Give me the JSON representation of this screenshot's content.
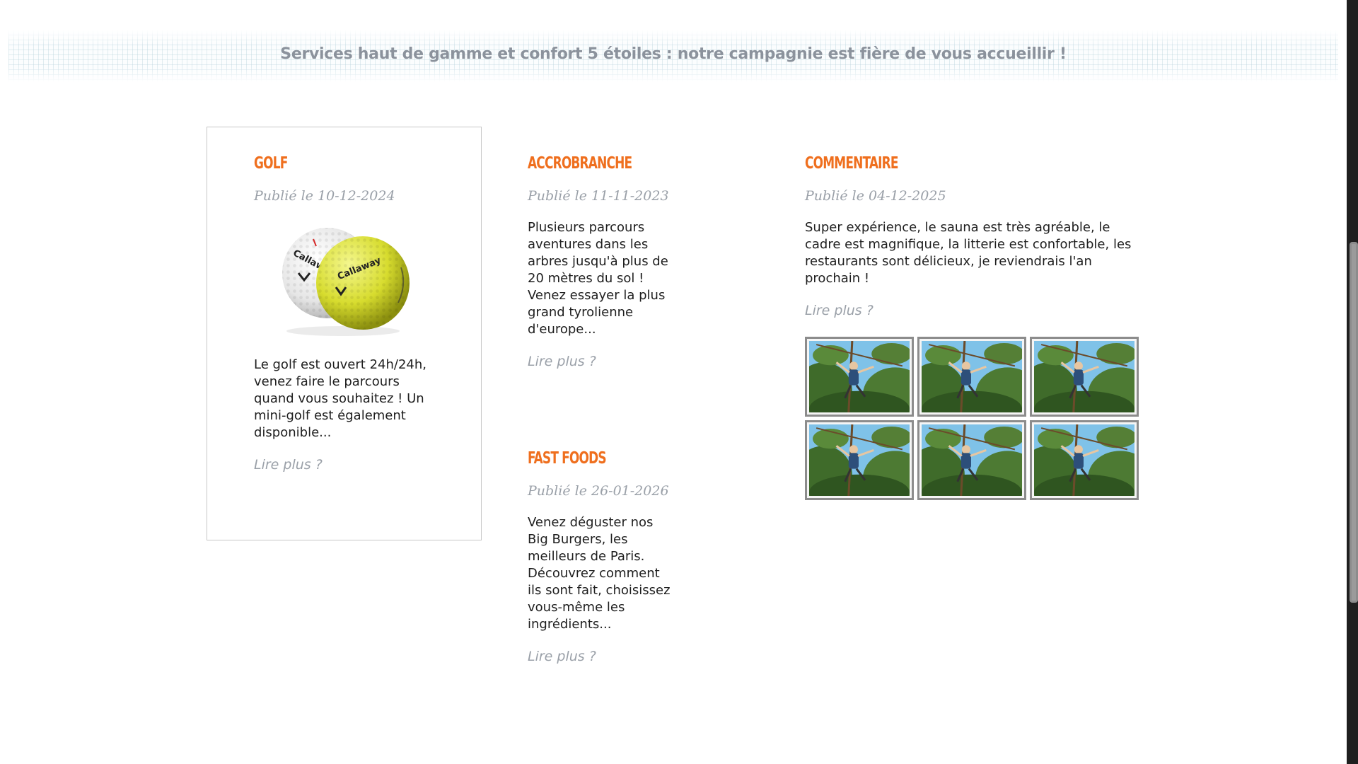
{
  "banner": {
    "tagline": "Services haut de gamme et confort 5 étoiles : notre campagnie est fière de vous accueillir !"
  },
  "posts": {
    "golf": {
      "title": "GOLF",
      "date": "Publié le 10-12-2024",
      "image_caption": "Callaway",
      "text": "Le golf est ouvert 24h/24h, venez faire le parcours quand vous souhaitez ! Un mini-golf est également disponible...",
      "read_more": "Lire plus ?"
    },
    "accrobranche": {
      "title": "ACCROBRANCHE",
      "date": "Publié le 11-11-2023",
      "text": "Plusieurs parcours aventures dans les arbres jusqu'à plus de 20 mètres du sol ! Venez essayer la plus grand tyrolienne d'europe...",
      "read_more": "Lire plus ?"
    },
    "fastfoods": {
      "title": "FAST FOODS",
      "date": "Publié le 26-01-2026",
      "text": "Venez déguster nos Big Burgers, les meilleurs de Paris. Découvrez comment ils sont fait, choisissez vous-même les ingrédients...",
      "read_more": "Lire plus ?"
    },
    "commentaire": {
      "title": "COMMENTAIRE",
      "date": "Publié le 04-12-2025",
      "text": "Super expérience, le sauna est très agréable, le cadre est magnifique, la litterie est confortable, les restaurants sont délicieux, je reviendrais l'an prochain !",
      "read_more": "Lire plus ?"
    }
  },
  "gallery": {
    "count": 6,
    "image_icon": "treetop-adventure-photo"
  },
  "colors": {
    "title": "#ef6f1e",
    "muted": "#9aa0a8",
    "tagline": "#8b929c",
    "thumb_border": "#8c8c8c"
  }
}
